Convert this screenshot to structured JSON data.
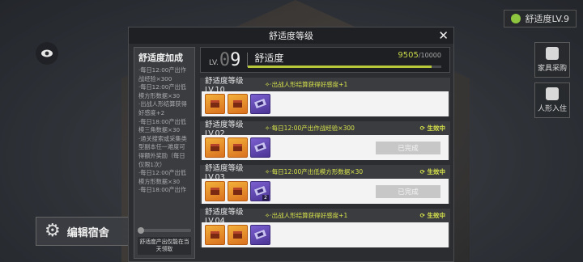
{
  "hud": {
    "comfort_badge": "舒适度LV.9",
    "furniture_shop": "家具采购",
    "doll_move_in": "人形入住",
    "edit_dorm": "编辑宿舍"
  },
  "modal": {
    "title": "舒适度等级",
    "close": "✕",
    "left": {
      "title": "舒适度加成",
      "lines": [
        "·每日12:00产出作战经验×300",
        "·每日12:00产出低模方形数据×30",
        "·出战人形结算获得好感度+2",
        "·每日18:00产出低模三角数据×30",
        "·通关搜索或采集类型副本任一难度可得额外奖励（每日仅限1次）",
        "·每日12:00产出低模方形数据×30",
        "·每日18:00产出作"
      ],
      "footer": "舒适度产出仅能在当天领取"
    },
    "level": {
      "lv_prefix": "LV.",
      "lv_zero": "0",
      "lv_num": "9",
      "name": "舒适度",
      "current": "9505",
      "max": "/10000",
      "progress": 0.9505
    },
    "tiers": [
      {
        "name": "舒适度等级 LV.10",
        "reward": "✧·出战人形结算获得好感度+1",
        "status": "",
        "items": [
          {
            "color": "orange",
            "count": ""
          },
          {
            "color": "orange",
            "count": ""
          },
          {
            "color": "purple",
            "count": ""
          }
        ],
        "done": ""
      },
      {
        "name": "舒适度等级 LV.02",
        "reward": "✧·每日12:00产出作战经验×300",
        "status": "⟳ 生效中",
        "items": [
          {
            "color": "orange",
            "count": ""
          },
          {
            "color": "orange",
            "count": ""
          },
          {
            "color": "purple",
            "count": ""
          }
        ],
        "done": "已完成"
      },
      {
        "name": "舒适度等级 LV.03",
        "reward": "✧·每日12:00产出低模方形数据×30",
        "status": "⟳ 生效中",
        "items": [
          {
            "color": "orange",
            "count": ""
          },
          {
            "color": "orange",
            "count": ""
          },
          {
            "color": "purple",
            "count": "2"
          }
        ],
        "done": "已完成"
      },
      {
        "name": "舒适度等级 LV.04",
        "reward": "✧·出战人形结算获得好感度+1",
        "status": "⟳ 生效中",
        "items": [],
        "done": ""
      }
    ]
  }
}
